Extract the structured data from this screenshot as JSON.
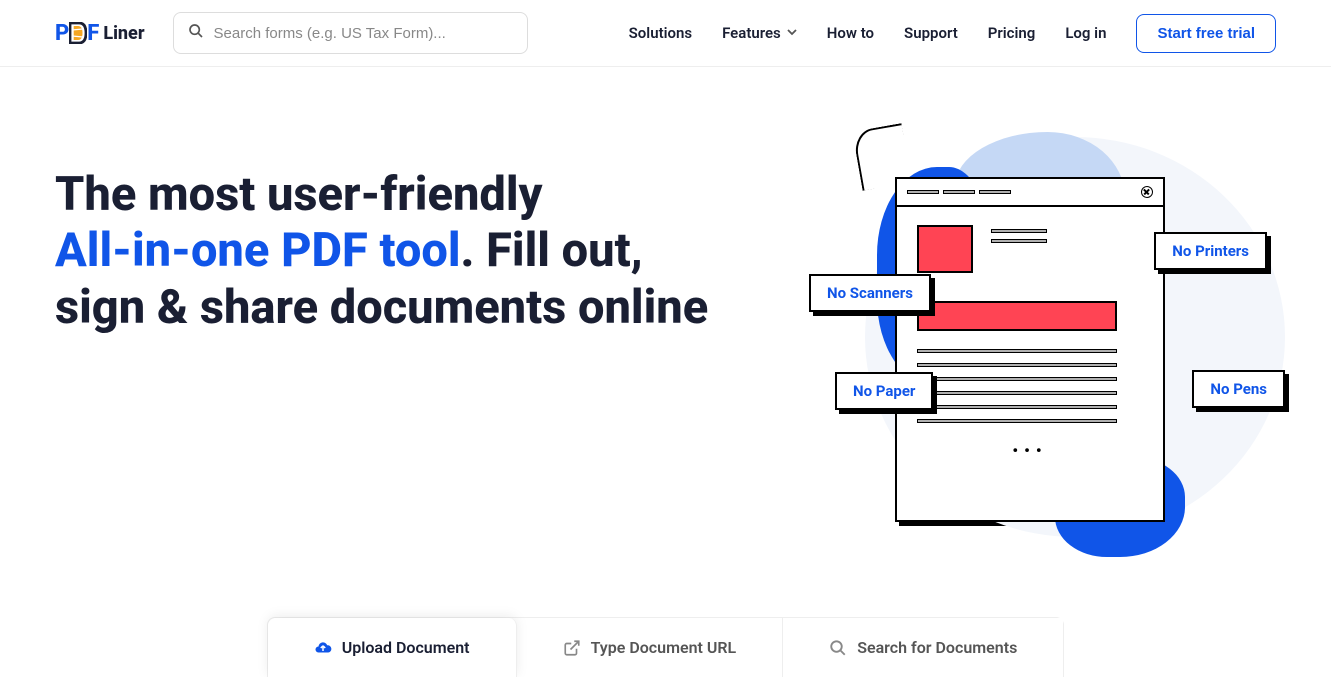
{
  "logo": {
    "text_p": "P",
    "text_f": "F",
    "text_liner": "Liner"
  },
  "search": {
    "placeholder": "Search forms (e.g. US Tax Form)..."
  },
  "nav": {
    "solutions": "Solutions",
    "features": "Features",
    "howto": "How to",
    "support": "Support",
    "pricing": "Pricing",
    "login": "Log in",
    "trial": "Start free trial"
  },
  "hero": {
    "line1": "The most user-friendly",
    "line2_blue": "All-in-one PDF tool",
    "line2_end": ". Fill out,",
    "line3": "sign & share documents online"
  },
  "tags": {
    "scanners": "No Scanners",
    "printers": "No Printers",
    "paper": "No Paper",
    "pens": "No Pens"
  },
  "tabs": {
    "upload": "Upload Document",
    "url": "Type Document URL",
    "search": "Search for Documents"
  }
}
